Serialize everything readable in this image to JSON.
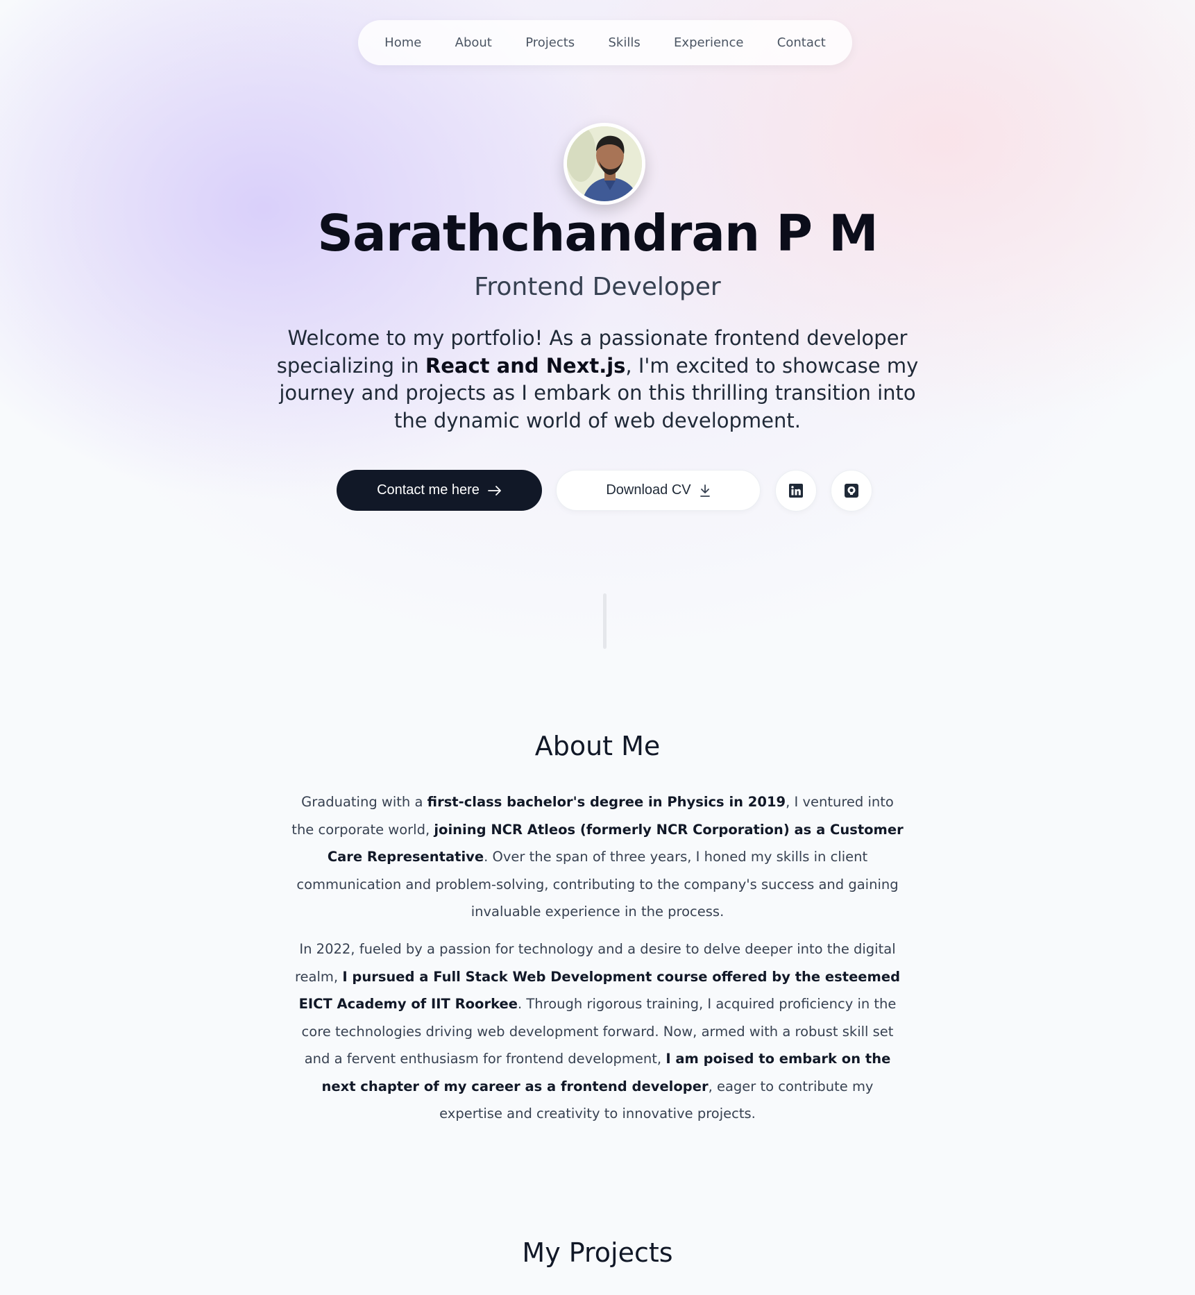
{
  "nav": {
    "items": [
      "Home",
      "About",
      "Projects",
      "Skills",
      "Experience",
      "Contact"
    ]
  },
  "hero": {
    "name": "Sarathchandran P M",
    "role": "Frontend Developer",
    "intro": {
      "before": "Welcome to my portfolio! As a passionate frontend developer specializing in ",
      "bold": "React and Next.js",
      "after": ", I'm excited to showcase my journey and projects as I embark on this thrilling transition into the dynamic world of web development."
    },
    "contact_button": "Contact me here",
    "download_button": "Download CV",
    "icons": {
      "contact": "arrow-right-icon",
      "download": "download-icon",
      "linkedin": "linkedin-icon",
      "github": "github-icon"
    }
  },
  "about": {
    "title": "About Me",
    "p1": {
      "t1": "Graduating with a ",
      "b1": "first-class bachelor's degree in Physics in 2019",
      "t2": ", I ventured into the corporate world, ",
      "b2": "joining NCR Atleos (formerly NCR Corporation) as a Customer Care Representative",
      "t3": ". Over the span of three years, I honed my skills in client communication and problem-solving, contributing to the company's success and gaining invaluable experience in the process."
    },
    "p2": {
      "t1": "In 2022, fueled by a passion for technology and a desire to delve deeper into the digital realm, ",
      "b1": "I pursued a Full Stack Web Development course offered by the esteemed EICT Academy of IIT Roorkee",
      "t2": ". Through rigorous training, I acquired proficiency in the core technologies driving web development forward. Now, armed with a robust skill set and a fervent enthusiasm for frontend development, ",
      "b2": "I am poised to embark on the next chapter of my career as a frontend developer",
      "t3": ", eager to contribute my expertise and creativity to innovative projects."
    }
  },
  "projects": {
    "title": "My Projects"
  },
  "colors": {
    "primary_button": "#111827",
    "background": "#f8fafc",
    "accent_purple": "#d8cefa",
    "accent_pink": "#fae2e8"
  }
}
